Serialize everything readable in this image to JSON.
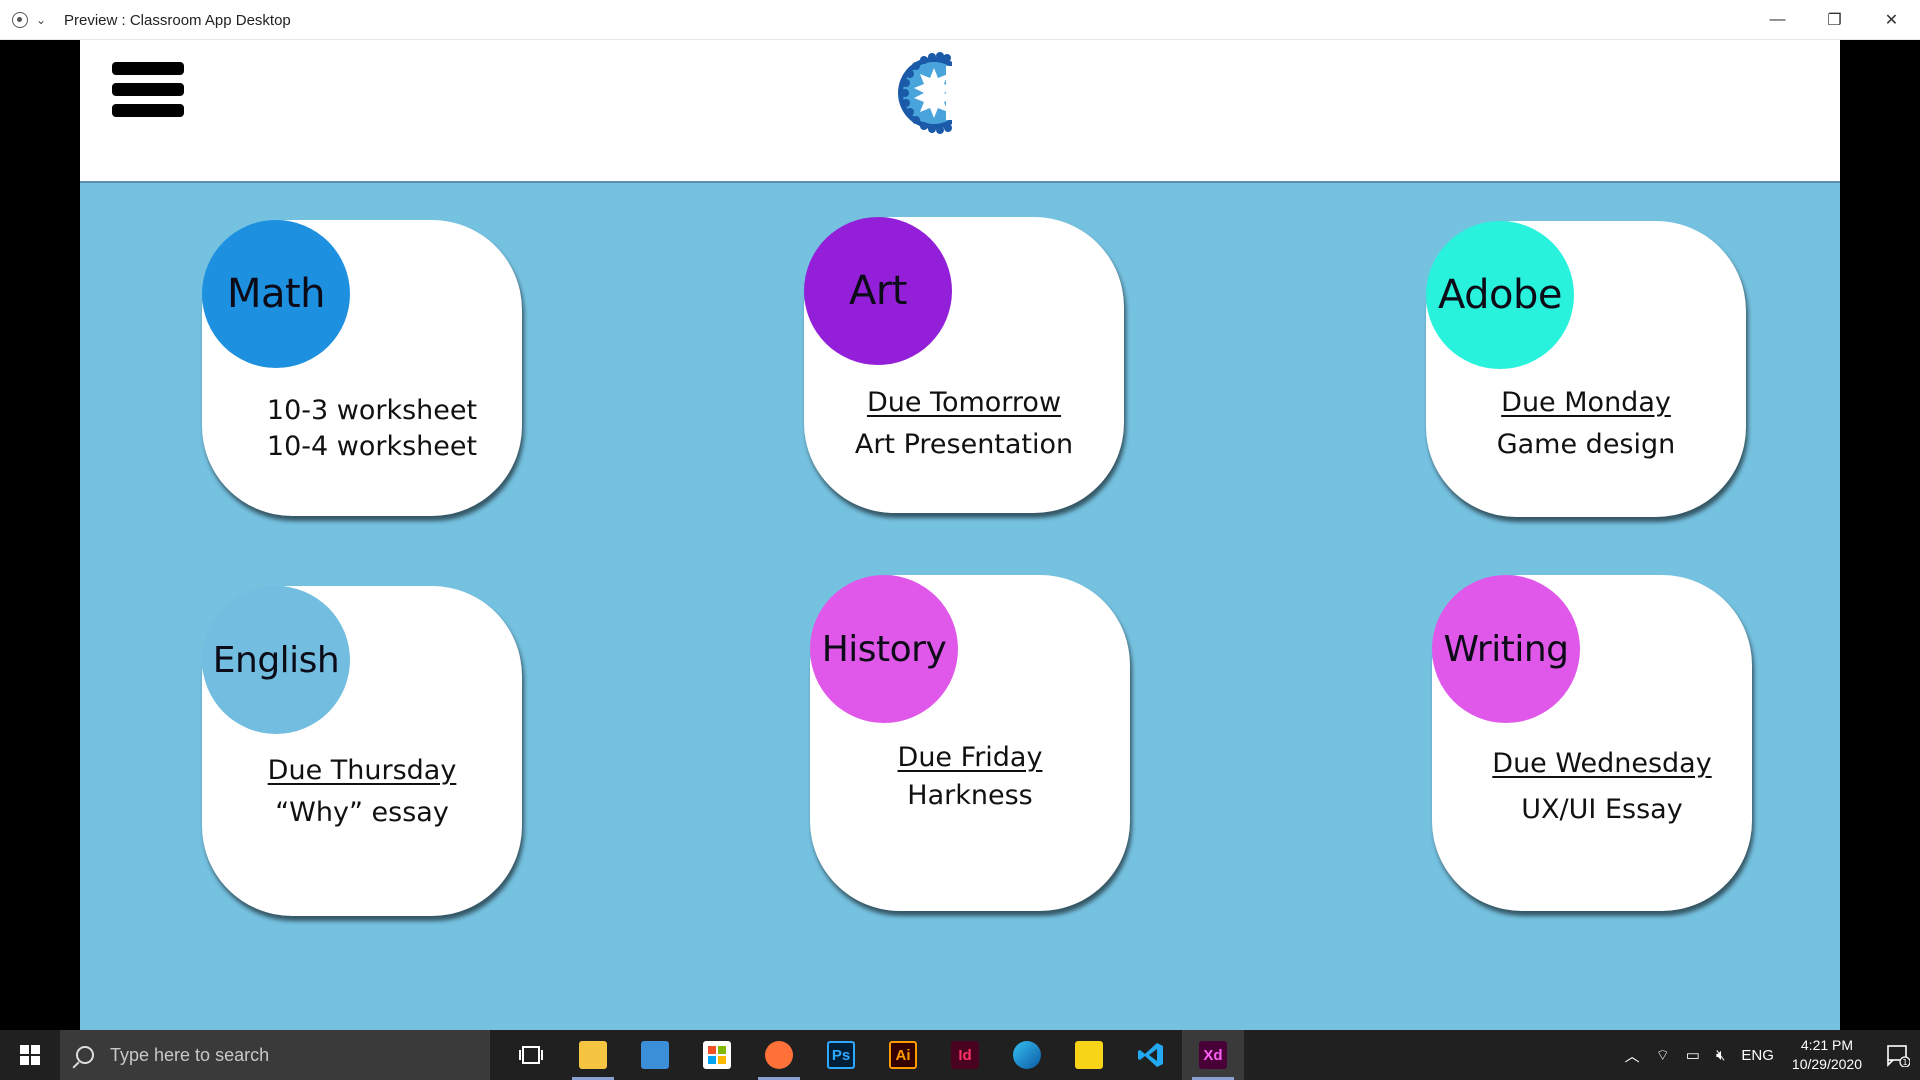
{
  "window": {
    "title": "Preview : Classroom App Desktop",
    "minimize": "—",
    "restore": "❐",
    "close": "✕"
  },
  "header": {
    "logo_letter": "C"
  },
  "cards": [
    {
      "subject": "Math",
      "badge_color": "#1e90e0",
      "line1": "10-3 worksheet",
      "line2": "10-4 worksheet",
      "line1_underlined": false
    },
    {
      "subject": "Art",
      "badge_color": "#9320d8",
      "line1": "Due Tomorrow",
      "line2": "Art Presentation",
      "line1_underlined": true
    },
    {
      "subject": "Adobe",
      "badge_color": "#28f2dc",
      "line1": "Due Monday",
      "line2": "Game design",
      "line1_underlined": true
    },
    {
      "subject": "English",
      "badge_color": "#72bde0",
      "line1": "Due Thursday",
      "line2": "“Why” essay",
      "line1_underlined": true
    },
    {
      "subject": "History",
      "badge_color": "#e058ea",
      "line1": "Due Friday",
      "line2": "Harkness",
      "line1_underlined": true
    },
    {
      "subject": "Writing",
      "badge_color": "#e058ea",
      "line1": "Due Wednesday",
      "line2": "UX/UI Essay",
      "line1_underlined": true
    }
  ],
  "taskbar": {
    "search_placeholder": "Type here to search",
    "apps": [
      "task-view",
      "file-explorer",
      "mail",
      "store",
      "firefox",
      "photoshop",
      "illustrator",
      "indesign",
      "edge",
      "sticky-notes",
      "vscode",
      "adobe-xd"
    ],
    "ps_label": "Ps",
    "ai_label": "Ai",
    "id_label": "Id",
    "xd_label": "Xd",
    "language": "ENG",
    "time": "4:21 PM",
    "date": "10/29/2020",
    "notification_count": "1"
  }
}
